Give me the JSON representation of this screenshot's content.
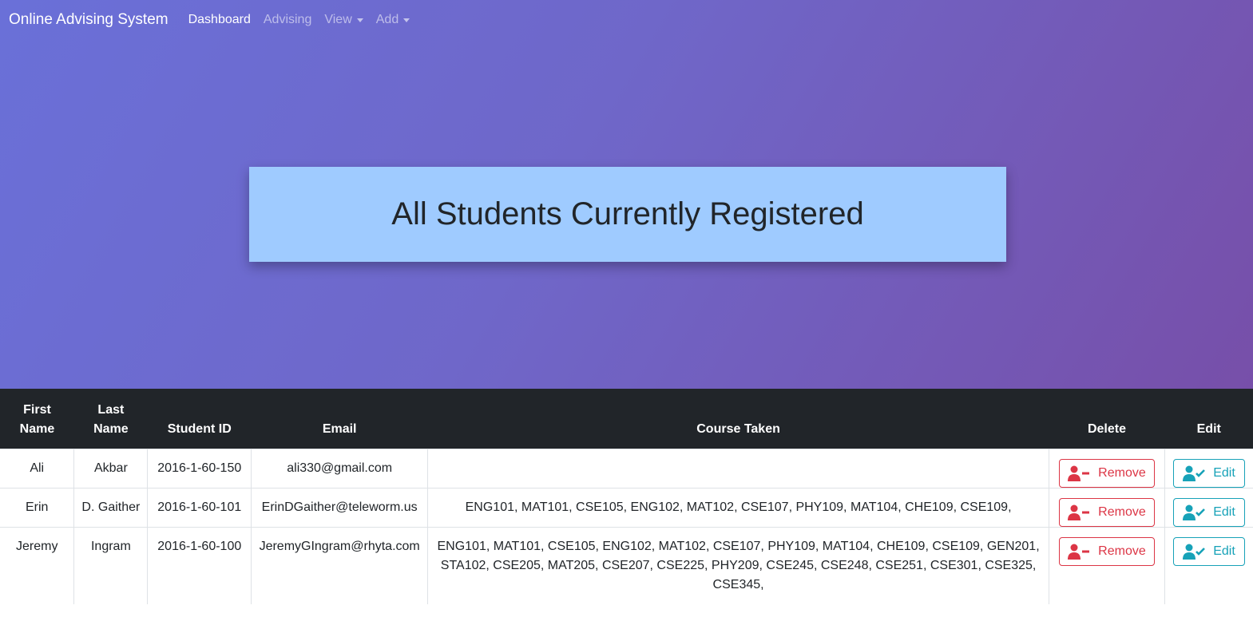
{
  "nav": {
    "brand": "Online Advising System",
    "items": [
      {
        "label": "Dashboard"
      },
      {
        "label": "Advising"
      },
      {
        "label": "View"
      },
      {
        "label": "Add"
      }
    ]
  },
  "banner": {
    "title": "All Students Currently Registered"
  },
  "table": {
    "headers": {
      "first_name": "First Name",
      "last_name": "Last Name",
      "student_id": "Student ID",
      "email": "Email",
      "courses": "Course Taken",
      "delete": "Delete",
      "edit": "Edit"
    },
    "rows": [
      {
        "first_name": "Ali",
        "last_name": "Akbar",
        "student_id": "2016-1-60-150",
        "email": "ali330@gmail.com",
        "courses": "",
        "remove_label": "Remove",
        "edit_label": "Edit"
      },
      {
        "first_name": "Erin",
        "last_name": "D. Gaither",
        "student_id": "2016-1-60-101",
        "email": "ErinDGaither@teleworm.us",
        "courses": "ENG101, MAT101, CSE105, ENG102, MAT102, CSE107, PHY109, MAT104, CHE109, CSE109,",
        "remove_label": "Remove",
        "edit_label": "Edit"
      },
      {
        "first_name": "Jeremy",
        "last_name": "Ingram",
        "student_id": "2016-1-60-100",
        "email": "JeremyGIngram@rhyta.com",
        "courses": "ENG101, MAT101, CSE105, ENG102, MAT102, CSE107, PHY109, MAT104, CHE109, CSE109, GEN201, STA102, CSE205, MAT205, CSE207, CSE225, PHY209, CSE245, CSE248, CSE251, CSE301, CSE325, CSE345,",
        "remove_label": "Remove",
        "edit_label": "Edit"
      }
    ]
  },
  "colors": {
    "danger": "#dc3545",
    "info": "#17a2b8",
    "banner": "#9fcbff",
    "table_head": "#212529"
  },
  "icons": {
    "remove": "user-minus-icon",
    "edit": "user-check-icon"
  }
}
